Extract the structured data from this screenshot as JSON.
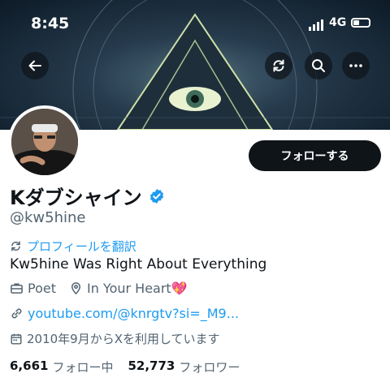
{
  "status_bar": {
    "time": "8:45",
    "network": "4G"
  },
  "header": {
    "back_icon": "arrow-left-icon",
    "refresh_icon": "refresh-icon",
    "search_icon": "search-icon",
    "more_icon": "more-icon"
  },
  "profile": {
    "name": "Kダブシャイン",
    "handle": "@kw5hine",
    "follow_label": "フォローする",
    "translate_label": "プロフィールを翻訳",
    "bio": "Kw5hine Was Right About Everything",
    "job": "Poet",
    "location": "In Your Heart💖",
    "url": "youtube.com/@knrgtv?si=_M9...",
    "joined": "2010年9月からXを利用しています",
    "following_count": "6,661",
    "following_label": "フォロー中",
    "followers_count": "52,773",
    "followers_label": "フォロワー"
  },
  "colors": {
    "accent": "#1d9bf0",
    "text": "#0f1419",
    "muted": "#536471",
    "button_bg": "#0f1419"
  }
}
